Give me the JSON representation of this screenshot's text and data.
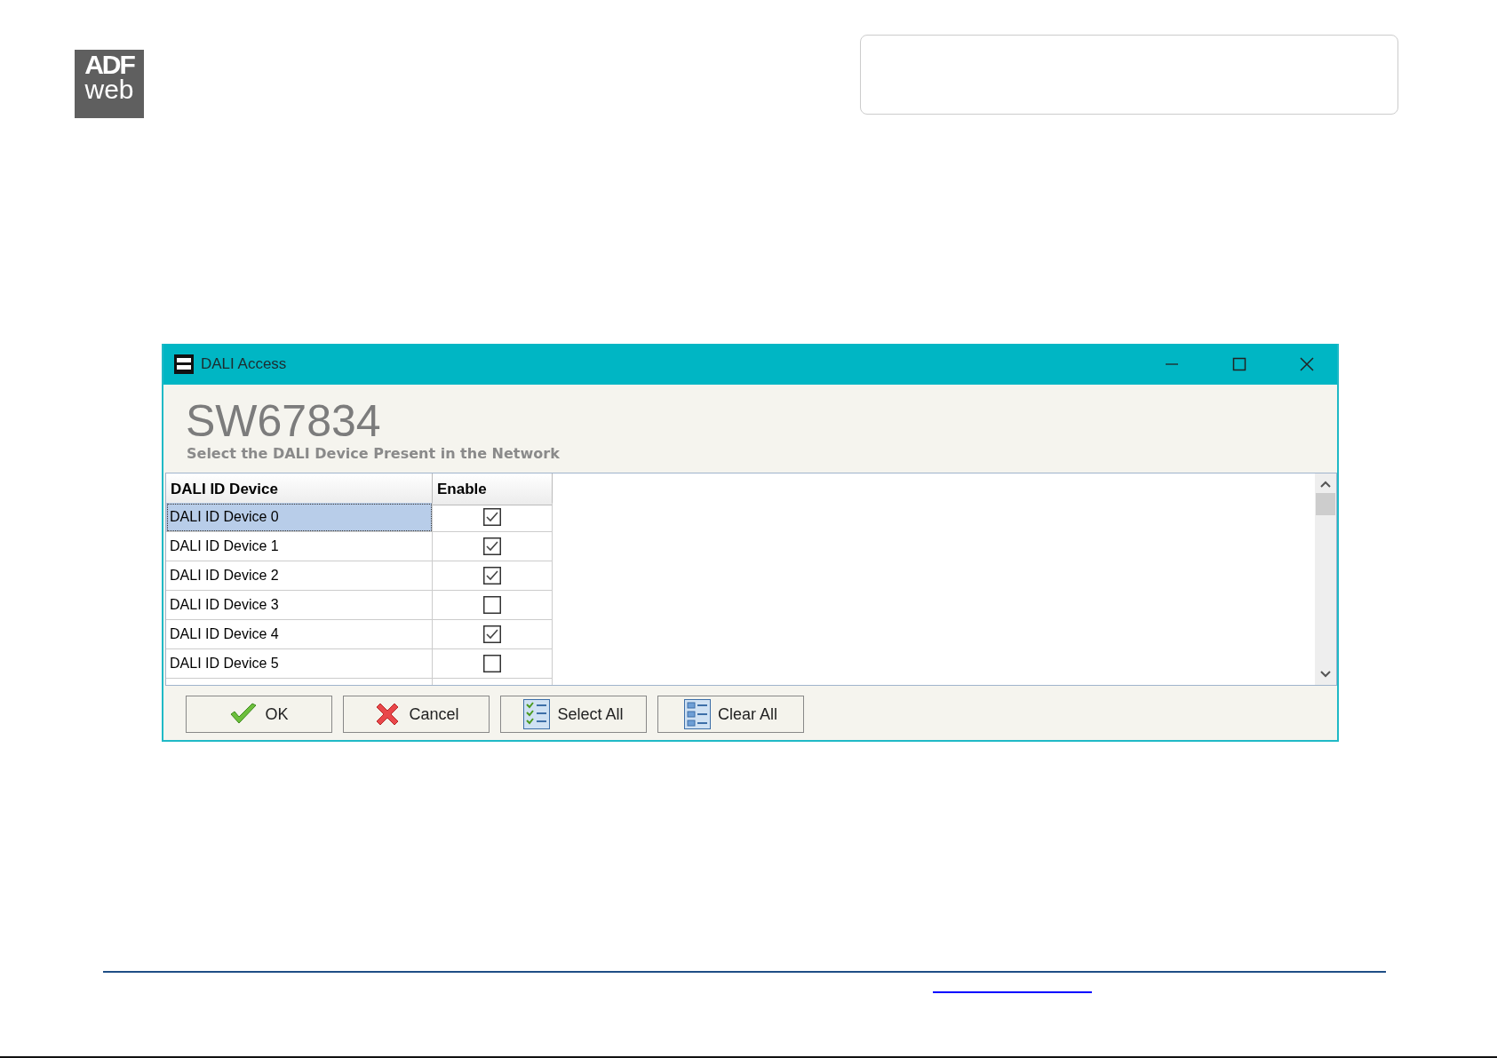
{
  "logo": {
    "line_1": "ADF",
    "line_2": "web"
  },
  "dialog": {
    "title": "DALI Access",
    "heading": "SW67834",
    "subtitle": "Select the DALI Device Present in the  Network"
  },
  "table": {
    "columns": [
      "DALI ID Device",
      "Enable"
    ],
    "rows": [
      {
        "device": "DALI ID Device 0",
        "checked": true,
        "selected": true
      },
      {
        "device": "DALI ID Device 1",
        "checked": true,
        "selected": false
      },
      {
        "device": "DALI ID Device 2",
        "checked": true,
        "selected": false
      },
      {
        "device": "DALI ID Device 3",
        "checked": false,
        "selected": false
      },
      {
        "device": "DALI ID Device 4",
        "checked": true,
        "selected": false
      },
      {
        "device": "DALI ID Device 5",
        "checked": false,
        "selected": false
      }
    ]
  },
  "buttons": [
    {
      "kind": "ok",
      "label": "OK"
    },
    {
      "kind": "cancel",
      "label": "Cancel"
    },
    {
      "kind": "select",
      "label": "Select All"
    },
    {
      "kind": "clear",
      "label": "Clear All"
    }
  ]
}
